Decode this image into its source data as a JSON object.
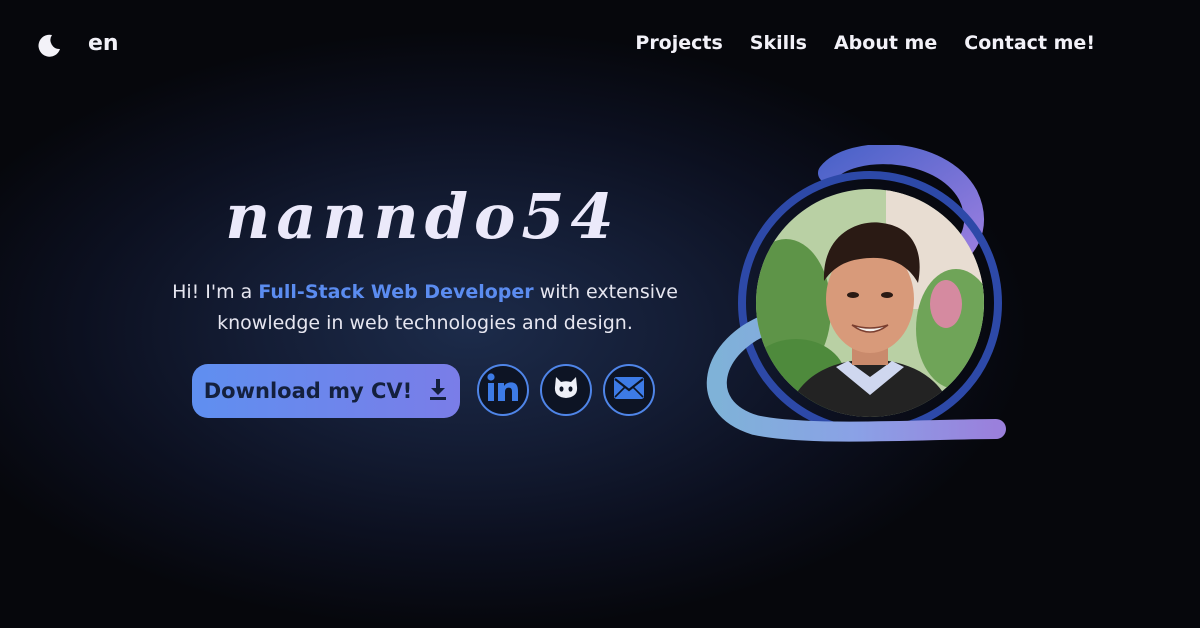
{
  "header": {
    "theme_icon": "moon-icon",
    "language": "en",
    "nav": [
      {
        "label": "Projects"
      },
      {
        "label": "Skills"
      },
      {
        "label": "About me"
      },
      {
        "label": "Contact me!"
      }
    ]
  },
  "hero": {
    "name": "nanndo54",
    "intro_before": "Hi! I'm a ",
    "intro_highlight": "Full-Stack Web Developer",
    "intro_after": " with extensive knowledge in web technologies and design.",
    "cv_button": "Download my CV!",
    "cv_icon": "download-icon",
    "social": [
      {
        "icon": "linkedin-icon"
      },
      {
        "icon": "github-icon"
      },
      {
        "icon": "email-icon"
      }
    ],
    "avatar_icon": "profile-photo"
  },
  "colors": {
    "accent": "#5b8cf0",
    "button_start": "#5f8ff0",
    "button_end": "#7a7de8",
    "background": "#06070c",
    "ring_light": "#8ea8ee",
    "ring_purple": "#8a7de0"
  }
}
